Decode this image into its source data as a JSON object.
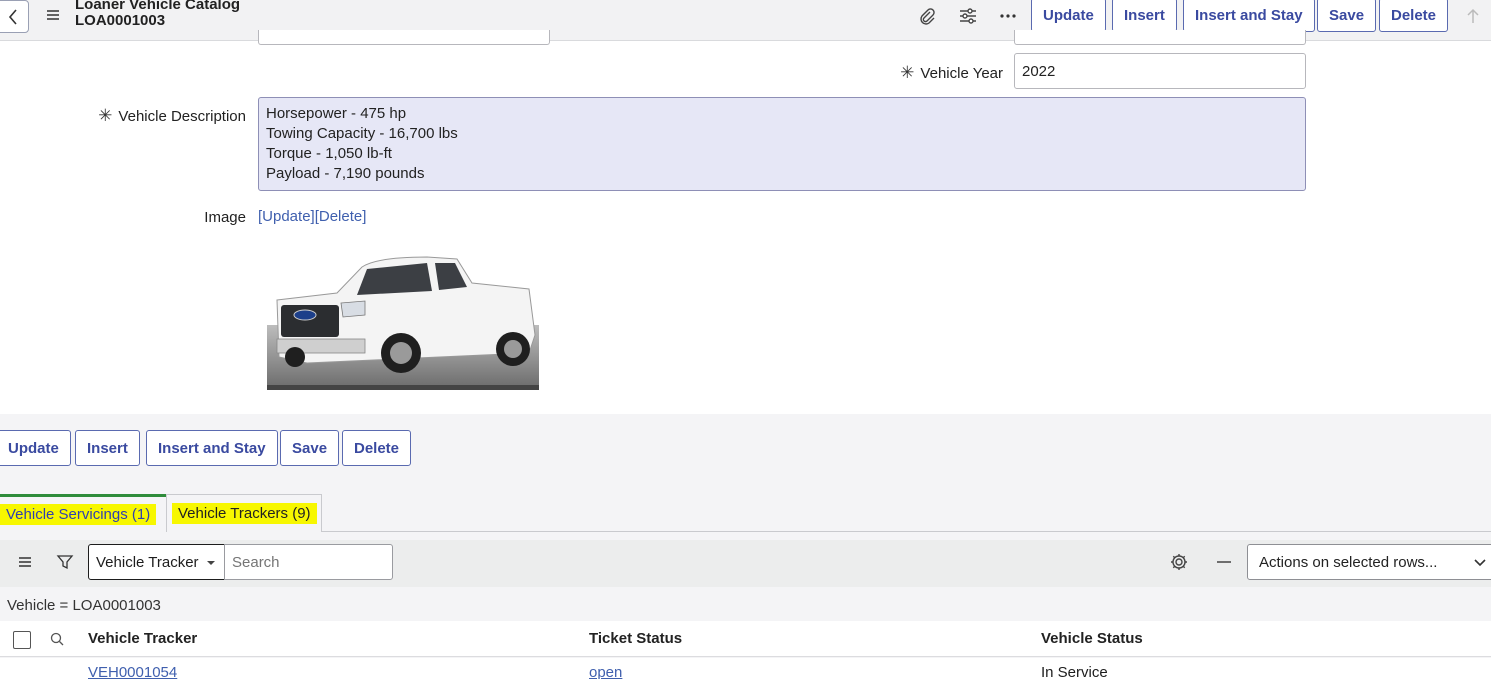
{
  "header": {
    "title": "Loaner Vehicle Catalog",
    "record_number": "LOA0001003",
    "icons": [
      "back-chevron-icon",
      "hamburger-menu-icon",
      "paperclip-icon",
      "sliders-icon",
      "more-dots-icon",
      "scroll-up-arrow-icon"
    ],
    "buttons": {
      "update": "Update",
      "insert": "Insert",
      "insert_and_stay": "Insert and Stay",
      "save": "Save",
      "delete": "Delete"
    }
  },
  "form": {
    "required_marker": "✳",
    "vehicle_year": {
      "label": "Vehicle Year",
      "value": "2022"
    },
    "vehicle_description": {
      "label": "Vehicle Description",
      "lines": [
        "Horsepower - 475 hp",
        "Towing Capacity - 16,700 lbs",
        "Torque - 1,050 lb-ft",
        "Payload - 7,190 pounds"
      ]
    },
    "image": {
      "label": "Image",
      "update_link": "[Update]",
      "delete_link": "[Delete]",
      "alt": "white pickup truck"
    }
  },
  "bottom_buttons": {
    "update": "Update",
    "insert": "Insert",
    "insert_and_stay": "Insert and Stay",
    "save": "Save",
    "delete": "Delete"
  },
  "tabs": [
    {
      "label": "Vehicle Servicings (1)",
      "active": true
    },
    {
      "label": "Vehicle Trackers (9)",
      "active": false
    }
  ],
  "list": {
    "field_select": "Vehicle Tracker",
    "search_placeholder": "Search",
    "actions_select": "Actions on selected rows...",
    "filter": "Vehicle = LOA0001003",
    "columns": [
      "Vehicle Tracker",
      "Ticket Status",
      "Vehicle Status"
    ],
    "rows": [
      {
        "vehicle_tracker": "VEH0001054",
        "ticket_status": "open",
        "vehicle_status": "In Service"
      }
    ]
  },
  "colors": {
    "button_text": "#3a4aa0",
    "link": "#3f5fae",
    "highlight": "#f7f700",
    "description_bg": "#e6e7f6"
  }
}
